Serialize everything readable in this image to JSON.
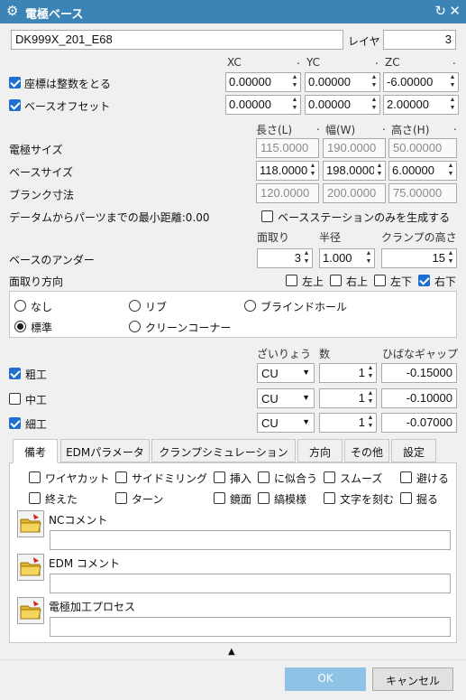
{
  "window": {
    "title": "電極ベース",
    "gear_icon": "gear-icon",
    "reset_icon": "reset-icon",
    "close_icon": "close-icon"
  },
  "top": {
    "name_value": "DK999X_201_E68",
    "layer_label": "レイヤ",
    "layer_value": "3"
  },
  "coords": {
    "xc": "XC",
    "yc": "YC",
    "zc": "ZC",
    "dot": ".",
    "integer_label": "座標は整数をとる",
    "integer_checked": true,
    "integer_values": [
      "0.00000",
      "0.00000",
      "-6.00000"
    ],
    "offset_label": "ベースオフセット",
    "offset_checked": true,
    "offset_values": [
      "0.00000",
      "0.00000",
      "2.00000"
    ]
  },
  "size": {
    "h_len": "長さ(L)",
    "h_wid": "幅(W)",
    "h_hgt": "高さ(H)",
    "dot": ".",
    "electrode_label": "電極サイズ",
    "electrode_values": [
      "115.0000",
      "190.0000",
      "50.00000"
    ],
    "base_label": "ベースサイズ",
    "base_values": [
      "118.0000",
      "198.0000",
      "6.00000"
    ],
    "blank_label": "ブランク寸法",
    "blank_values": [
      "120.0000",
      "200.0000",
      "75.00000"
    ]
  },
  "datum": {
    "label": "データムからパーツまでの最小距離:0.00",
    "station_label": "ベースステーションのみを生成する",
    "station_checked": false
  },
  "under": {
    "h_chamfer": "面取り",
    "h_radius": "半径",
    "h_clamp": "クランプの高さ",
    "label": "ベースのアンダー",
    "chamfer": "3",
    "radius": "1.000",
    "clamp": "15"
  },
  "chamfer_dir": {
    "label": "面取り方向",
    "opts": [
      "左上",
      "右上",
      "左下",
      "右下"
    ],
    "checked": [
      false,
      false,
      false,
      true
    ]
  },
  "radios": {
    "none": "なし",
    "rib": "リブ",
    "blind": "ブラインドホール",
    "standard": "標準",
    "clean": "クリーンコーナー",
    "selected": "standard"
  },
  "process": {
    "h_spark": "ざいりょう",
    "h_num": "数",
    "h_gap": "ひばなギャップ",
    "rows": [
      {
        "label": "粗工",
        "checked": true,
        "mat": "CU",
        "num": "1",
        "gap": "-0.15000"
      },
      {
        "label": "中工",
        "checked": false,
        "mat": "CU",
        "num": "1",
        "gap": "-0.10000"
      },
      {
        "label": "細工",
        "checked": true,
        "mat": "CU",
        "num": "1",
        "gap": "-0.07000"
      }
    ]
  },
  "tabs": [
    "備考",
    "EDMパラメータ",
    "クランプシミュレーション",
    "方向",
    "その他",
    "設定"
  ],
  "notes": {
    "row1": [
      "ワイヤカット",
      "サイドミリング",
      "挿入",
      "に似合う",
      "スムーズ",
      "避ける"
    ],
    "row2": [
      "終えた",
      "ターン",
      "鏡面",
      "縞模様",
      "文字を刻む",
      "掘る"
    ],
    "nc": "NCコメント",
    "edm": "EDM コメント",
    "proc": "電極加工プロセス",
    "folder_icon": "folder-icon"
  },
  "footer": {
    "ok": "OK",
    "cancel": "キャンセル",
    "collapse_icon": "triangle-up-icon"
  }
}
